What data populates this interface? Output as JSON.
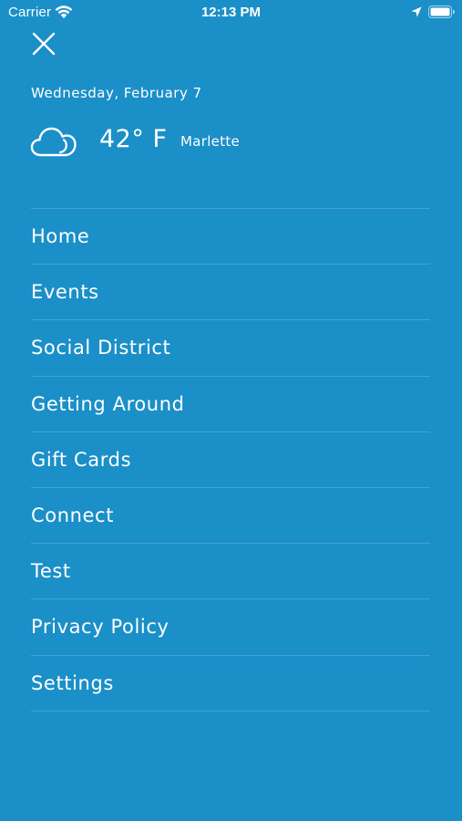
{
  "status_bar": {
    "carrier": "Carrier",
    "time": "12:13 PM"
  },
  "header": {
    "date": "Wednesday, February 7"
  },
  "weather": {
    "temperature": "42° F",
    "location": "Marlette",
    "icon": "cloud-icon"
  },
  "menu": {
    "items": [
      {
        "label": "Home"
      },
      {
        "label": "Events"
      },
      {
        "label": "Social District"
      },
      {
        "label": "Getting Around"
      },
      {
        "label": "Gift Cards"
      },
      {
        "label": "Connect"
      },
      {
        "label": "Test"
      },
      {
        "label": "Privacy Policy"
      },
      {
        "label": "Settings"
      }
    ]
  },
  "colors": {
    "background": "#1b8fc8",
    "text": "#ffffff"
  }
}
